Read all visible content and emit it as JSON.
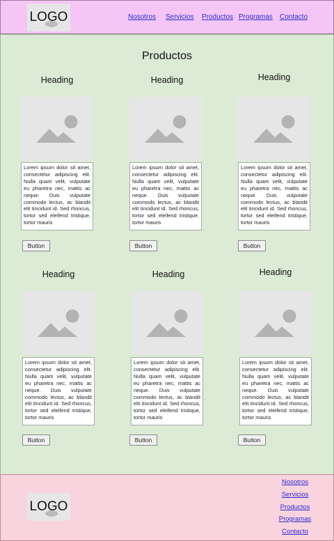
{
  "header": {
    "logo_text": "LOGO",
    "nav": [
      "Nosotros",
      "Servicios",
      "Productos",
      "Programas",
      "Contacto"
    ]
  },
  "main": {
    "title": "Productos",
    "cards": [
      {
        "heading": "Heading",
        "text": "Lorem ipsum dolor sit amet, consectetur adipiscing elit. Nulla quam velit, vulputate eu pharetra nec, mattis ac neque. Duis vulputate commodo lectus, ac blandit elit tincidunt id. Sed rhoncus, tortor sed eleifend tristique, tortor mauris",
        "button": "Button"
      },
      {
        "heading": "Heading",
        "text": "Lorem ipsum dolor sit amet, consectetur adipiscing elit. Nulla quam velit, vulputate eu pharetra nec, mattis ac neque. Duis vulputate commodo lectus, ac blandit elit tincidunt id. Sed rhoncus, tortor sed eleifend tristique, tortor mauris",
        "button": "Button"
      },
      {
        "heading": "Heading",
        "text": "Lorem ipsum dolor sit amet, consectetur adipiscing elit. Nulla quam velit, vulputate eu pharetra nec, mattis ac neque. Duis vulputate commodo lectus, ac blandit elit tincidunt id. Sed rhoncus, tortor sed eleifend tristique, tortor mauris",
        "button": "Button"
      },
      {
        "heading": "Heading",
        "text": "Lorem ipsum dolor sit amet, consectetur adipiscing elit. Nulla quam velit, vulputate eu pharetra nec, mattis ac neque. Duis vulputate commodo lectus, ac blandit elit tincidunt id. Sed rhoncus, tortor sed eleifend tristique, tortor mauris",
        "button": "Button"
      },
      {
        "heading": "Heading",
        "text": "Lorem ipsum dolor sit amet, consectetur adipiscing elit. Nulla quam velit, vulputate eu pharetra nec, mattis ac neque. Duis vulputate commodo lectus, ac blandit elit tincidunt id. Sed rhoncus, tortor sed eleifend tristique, tortor mauris",
        "button": "Button"
      },
      {
        "heading": "Heading",
        "text": "Lorem ipsum dolor sit amet, consectetur adipiscing elit. Nulla quam velit, vulputate eu pharetra nec, mattis ac neque. Duis vulputate commodo lectus, ac blandit elit tincidunt id. Sed rhoncus, tortor sed eleifend tristique, tortor mauris",
        "button": "Button"
      }
    ]
  },
  "footer": {
    "logo_text": "LOGO",
    "links": [
      "Nosotros",
      "Servicios",
      "Productos",
      "Programas",
      "Contacto"
    ]
  },
  "icons": {
    "logo": "logo-icon",
    "card_image": "image-placeholder-icon"
  },
  "colors": {
    "header_bg": "#f5c6f5",
    "main_bg": "#dcebd5",
    "footer_bg": "#f9d3de",
    "link": "#2b2bd6",
    "placeholder_bg": "#e6e6e6",
    "placeholder_glyph": "#b3b3b3"
  }
}
